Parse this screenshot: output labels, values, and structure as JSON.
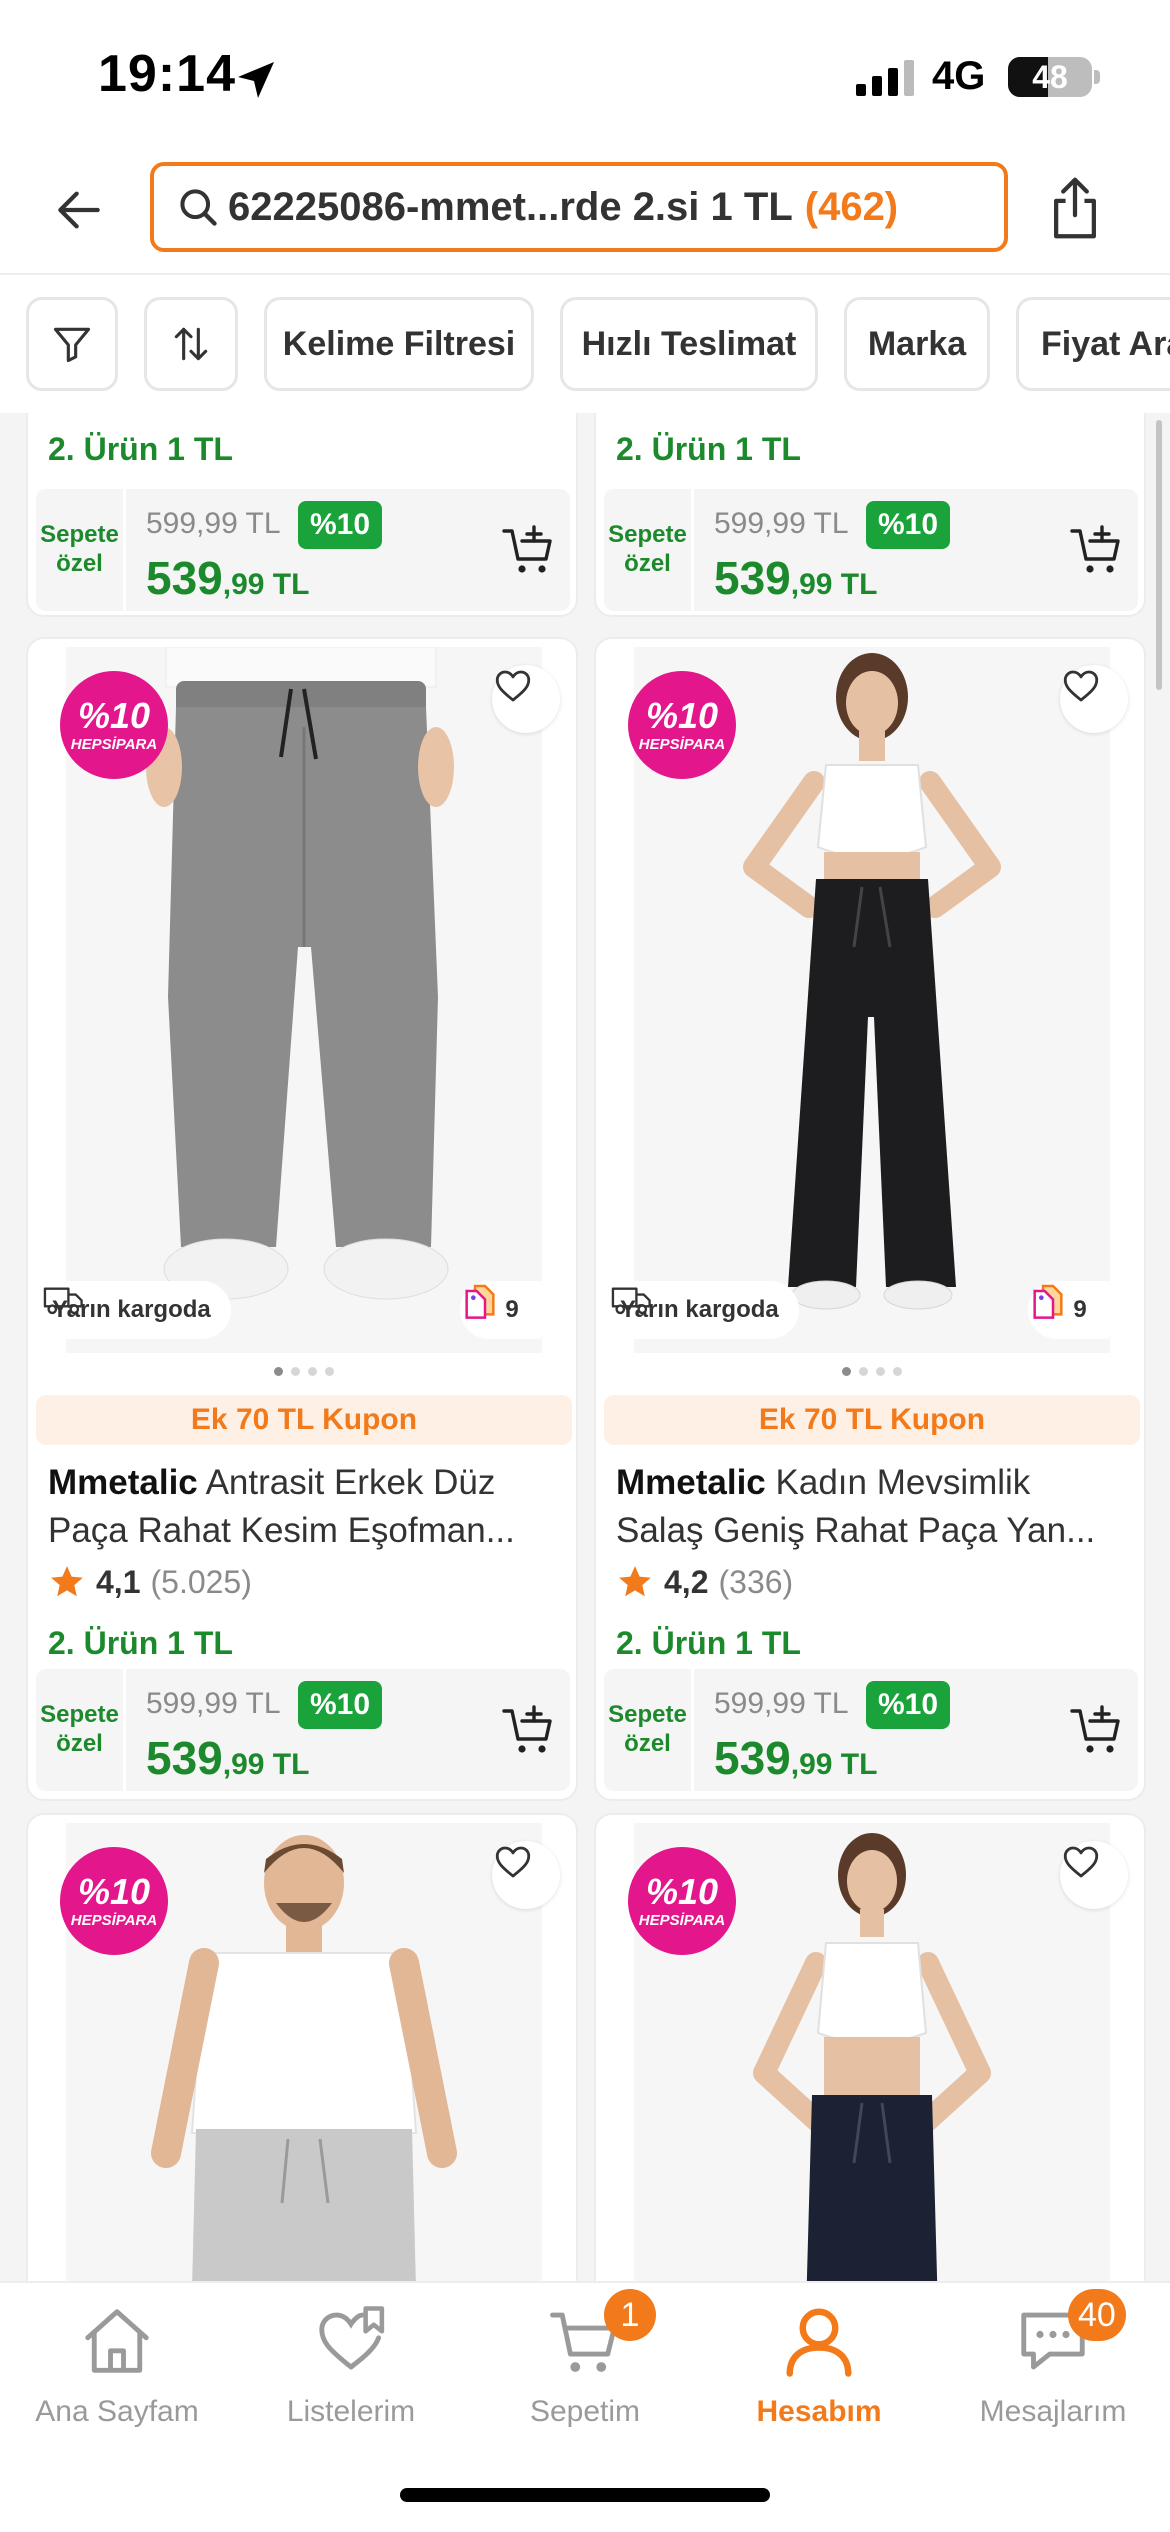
{
  "status_bar": {
    "time": "19:14",
    "network": "4G",
    "battery_level": "48",
    "battery_fraction": 0.48
  },
  "search": {
    "back_icon": "back-arrow-icon",
    "query": "62225086-mmet...rde 2.si 1 TL",
    "count": "(462)",
    "share_icon": "share-icon"
  },
  "filters": {
    "filter_icon": "funnel-icon",
    "sort_icon": "sort-icon",
    "chips": [
      "Kelime Filtresi",
      "Hızlı Teslimat",
      "Marka",
      "Fiyat Ara"
    ]
  },
  "colors": {
    "accent": "#f27a1a",
    "promo_green": "#1c8a2c",
    "discount_green": "#19a33a",
    "hepsipara_pink": "#e4168c"
  },
  "top_cards": [
    {
      "promo": "2. Ürün 1 TL",
      "price_label": "Sepete özel",
      "old_price": "599,99 TL",
      "discount": "%10",
      "new_price_int": "539",
      "new_price_dec": ",99 TL"
    },
    {
      "promo": "2. Ürün 1 TL",
      "price_label": "Sepete özel",
      "old_price": "599,99 TL",
      "discount": "%10",
      "new_price_int": "539",
      "new_price_dec": ",99 TL"
    }
  ],
  "products": [
    {
      "badge_pct": "%10",
      "badge_brand": "HEPSİPARA",
      "shipping": "Yarın kargoda",
      "variants": "9",
      "coupon": "Ek 70 TL Kupon",
      "brand": "Mmetalic",
      "title_rest_line1": "Antrasit Erkek Düz",
      "title_line2": "Paça Rahat Kesim Eşofman...",
      "rating": "4,1",
      "rating_count": "(5.025)",
      "promo": "2. Ürün 1 TL",
      "price_label": "Sepete özel",
      "old_price": "599,99 TL",
      "discount": "%10",
      "new_price_int": "539",
      "new_price_dec": ",99 TL"
    },
    {
      "badge_pct": "%10",
      "badge_brand": "HEPSİPARA",
      "shipping": "Yarın kargoda",
      "variants": "9",
      "coupon": "Ek 70 TL Kupon",
      "brand": "Mmetalic",
      "title_rest_line1": "Kadın Mevsimlik",
      "title_line2": "Salaş Geniş Rahat Paça Yan...",
      "rating": "4,2",
      "rating_count": "(336)",
      "promo": "2. Ürün 1 TL",
      "price_label": "Sepete özel",
      "old_price": "599,99 TL",
      "discount": "%10",
      "new_price_int": "539",
      "new_price_dec": ",99 TL"
    }
  ],
  "bottom_cards": [
    {
      "badge_pct": "%10",
      "badge_brand": "HEPSİPARA"
    },
    {
      "badge_pct": "%10",
      "badge_brand": "HEPSİPARA"
    }
  ],
  "tab_bar": {
    "tabs": [
      {
        "label": "Ana Sayfam",
        "icon": "home-icon",
        "badge": ""
      },
      {
        "label": "Listelerim",
        "icon": "heart-list-icon",
        "badge": ""
      },
      {
        "label": "Sepetim",
        "icon": "cart-icon",
        "badge": "1"
      },
      {
        "label": "Hesabım",
        "icon": "user-icon",
        "badge": ""
      },
      {
        "label": "Mesajlarım",
        "icon": "chat-icon",
        "badge": "40"
      }
    ],
    "active_tab": "Hesabım"
  }
}
